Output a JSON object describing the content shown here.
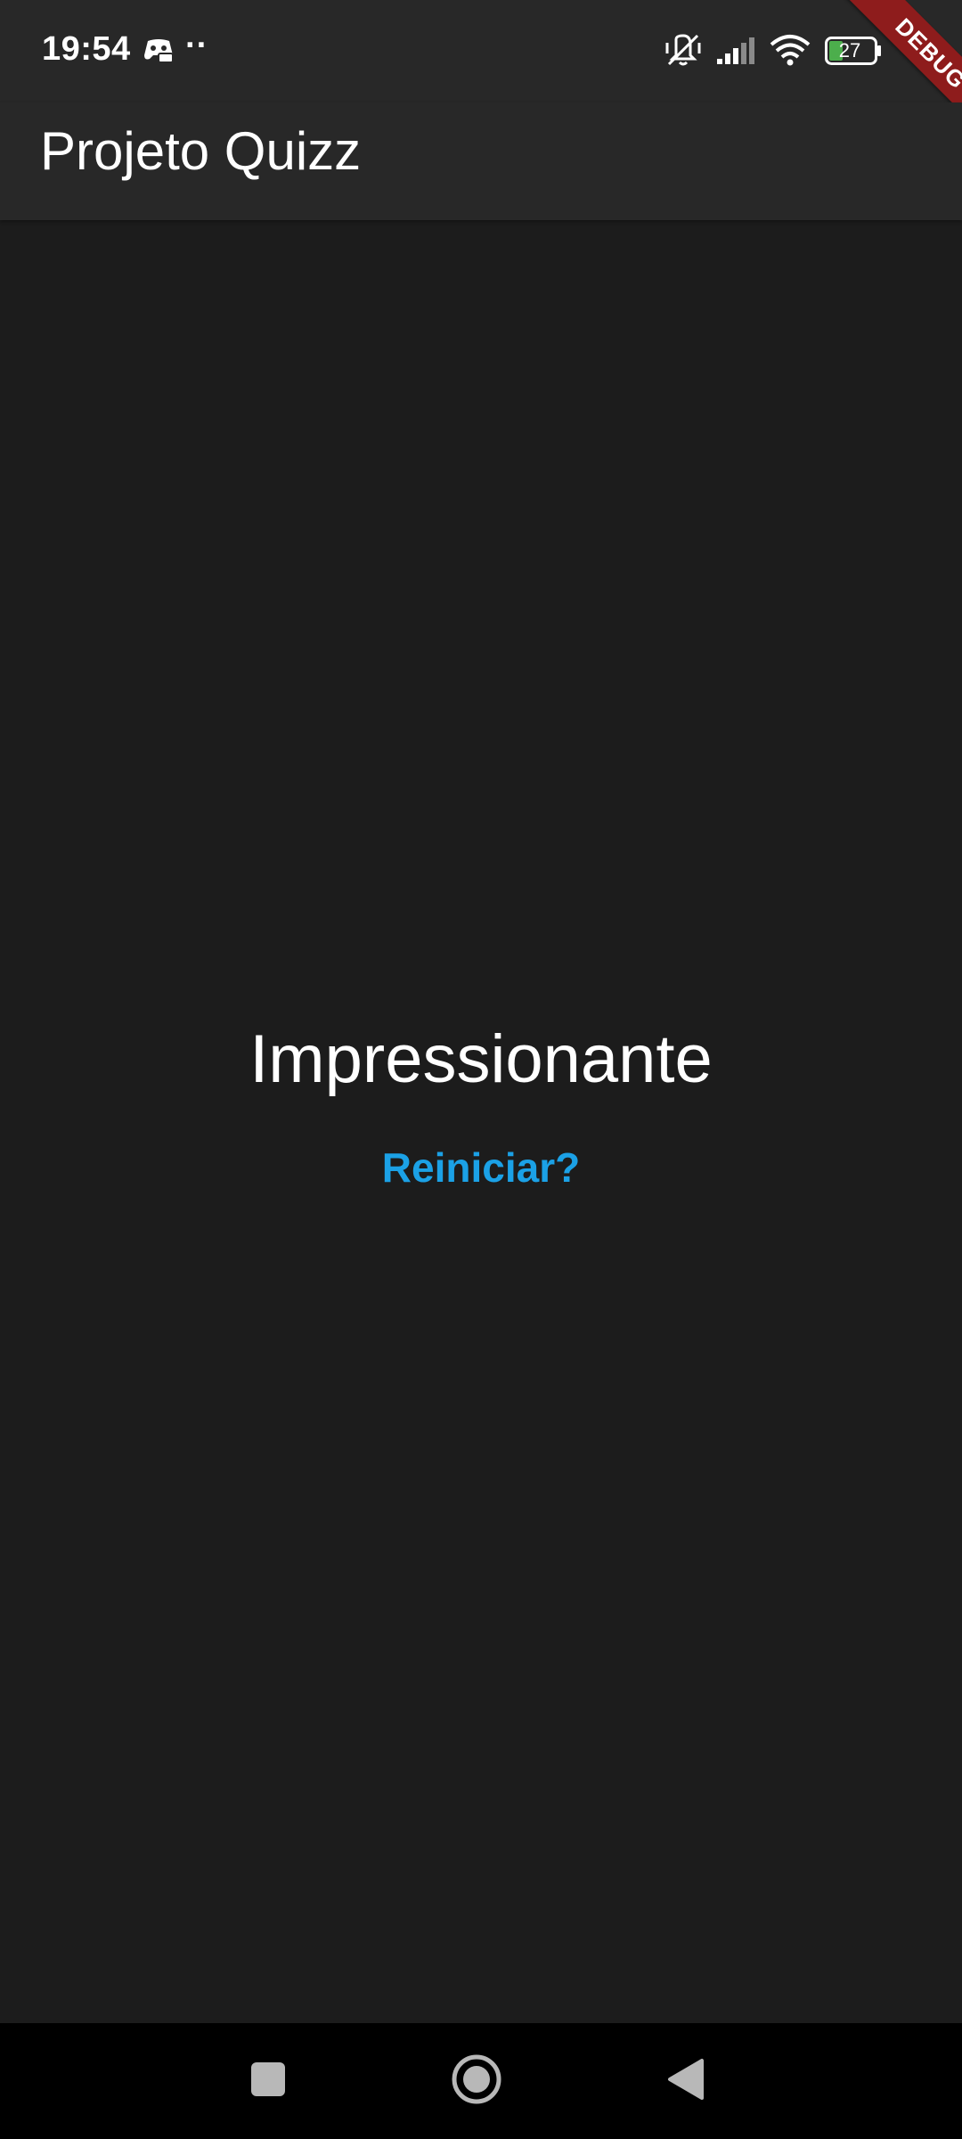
{
  "status_bar": {
    "time": "19:54",
    "battery_level": "27",
    "notification_dots": "··",
    "icons": [
      "game-controller-icon",
      "vibrate-off-icon",
      "signal-icon",
      "wifi-icon",
      "battery-icon"
    ]
  },
  "debug_banner": {
    "label": "DEBUG",
    "color": "#8e1c1c"
  },
  "app_bar": {
    "title": "Projeto Quizz"
  },
  "main": {
    "result_text": "Impressionante",
    "restart_label": "Reiniciar?"
  },
  "nav_bar": {
    "icons": [
      "recents-square-icon",
      "home-circle-icon",
      "back-triangle-icon"
    ]
  },
  "colors": {
    "background": "#1c1c1c",
    "app_bar": "#282828",
    "accent": "#1ba1e6",
    "battery_fill": "#4cae4c"
  }
}
